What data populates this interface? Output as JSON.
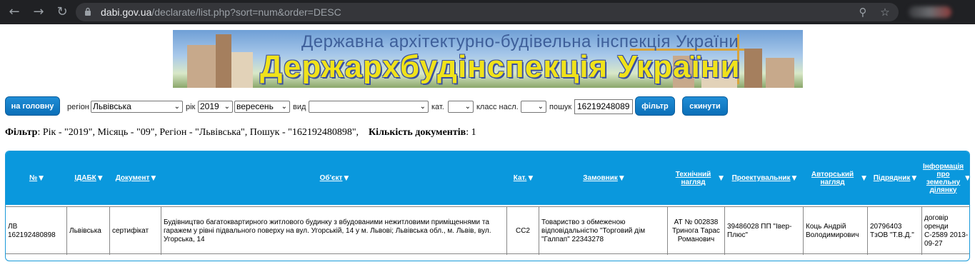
{
  "browser": {
    "url_host": "dabi.gov.ua",
    "url_path": "/declarate/list.php?sort=num&order=DESC"
  },
  "banner": {
    "subtitle": "Державна архітектурно-будівельна інспекція України",
    "title": "Держархбудінспекція України"
  },
  "filters": {
    "home_button": "на головну",
    "region_label": "регіон",
    "region_value": "Львівська",
    "year_label": "рік",
    "year_value": "2019",
    "month_value": "вересень",
    "type_label": "вид",
    "type_value": "",
    "cat_label": "кат.",
    "cat_value": "",
    "class_label": "класс насл.",
    "class_value": "",
    "search_label": "пошук",
    "search_value": "16219248089",
    "filter_button": "фільтр",
    "reset_button": "скинути"
  },
  "summary": {
    "filter_label": "Фільтр",
    "filter_text": ": Рік - \"2019\", Місяць - \"09\", Регіон - \"Львівська\", Пошук - \"162192480898\",",
    "count_label": "Кількість документів",
    "count_value": ": 1"
  },
  "table": {
    "headers": [
      "№",
      "ІДАБК",
      "Документ",
      "Об'єкт",
      "Кат.",
      "Замовник",
      "Технічний нагляд",
      "Проектувальник",
      "Авторський нагляд",
      "Підрядник",
      "Інформація про земельну ділянку"
    ],
    "sort_glyph": "▼",
    "row": {
      "num": "ЛВ 162192480898",
      "idabk": "Львівська",
      "doc": "сертифікат",
      "object": "Будівництво багатоквартирного житлового будинку з вбудованими нежитловими приміщеннями та гаражем у рівні підвального поверху на вул. Угорській, 14 у м. Львові; Львівська обл., м. Львів, вул. Угорська, 14",
      "cat": "СС2",
      "customer": "Товариство з обмеженою відповідальністю \"Торговий дім \"Галпап\" 22343278",
      "tech": "АТ № 002838 Тринога Тарас Романович",
      "designer": "39486028 ПП \"Івер-Плюс\"",
      "author": "Коць Андрій Володимирович",
      "contractor": "20796403 ТзОВ \"Т.В.Д.\"",
      "land": "договір оренди С-2589 2013-09-27"
    }
  }
}
